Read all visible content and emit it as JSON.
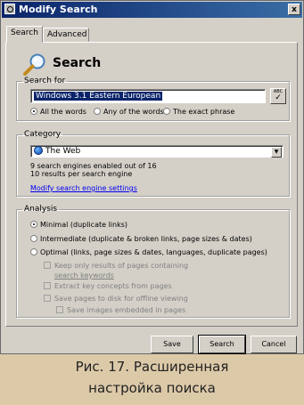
{
  "window": {
    "title": "Modify Search",
    "close": "x"
  },
  "tabs": [
    "Search",
    "Advanced"
  ],
  "header": {
    "title": "Search"
  },
  "search_for": {
    "legend": "Search for",
    "value": "Windows 3.1 Eastern European",
    "spell_label": "ABC",
    "options": [
      "All the words",
      "Any of the words",
      "The exact phrase"
    ],
    "selected": "All the words"
  },
  "category": {
    "legend": "Category",
    "selected": "The Web",
    "engines_info": "9 search engines enabled out of 16",
    "results_info": "10 results per search engine",
    "settings_link": "Modify search engine settings"
  },
  "analysis": {
    "legend": "Analysis",
    "options": [
      "Minimal (duplicate links)",
      "Intermediate (duplicate & broken links, page sizes & dates)",
      "Optimal (links, page sizes & dates, languages, duplicate pages)"
    ],
    "selected": "Minimal (duplicate links)",
    "checks": {
      "keep_only_line1": "Keep only results of pages containing",
      "keep_only_link": "search keywords",
      "extract": "Extract key concepts from pages",
      "save_pages": "Save pages to disk for offline viewing",
      "save_images": "Save images embedded in pages"
    }
  },
  "buttons": {
    "save": "Save",
    "search": "Search",
    "cancel": "Cancel"
  },
  "caption": {
    "line1": "Рис. 17. Расширенная",
    "line2": "настройка поиска"
  },
  "colors": {
    "title_bar": "#0a246a",
    "dialog": "#d4d0c8",
    "caption_bg": "#dcc9a8",
    "link": "#0000ee"
  }
}
